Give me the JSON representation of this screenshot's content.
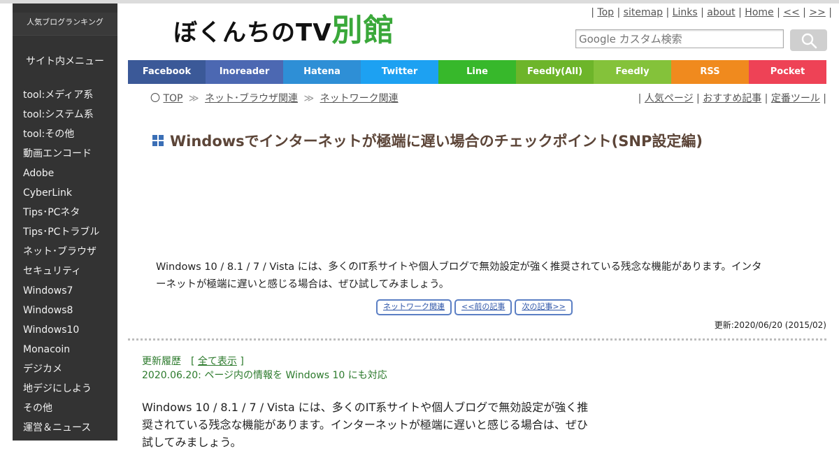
{
  "sidebar": {
    "ranking_label": "人気ブログランキング",
    "menu_title": "サイト内メニュー",
    "items": [
      "tool:メディア系",
      "tool:システム系",
      "tool:その他",
      "動画エンコード",
      "Adobe",
      "CyberLink",
      "Tips･PCネタ",
      "Tips･PCトラブル",
      "ネット･ブラウザ",
      "セキュリティ",
      "Windows7",
      "Windows8",
      "Windows10",
      "Monacoin",
      "デジカメ",
      "地デジにしよう",
      "その他",
      "運営＆ニュース"
    ]
  },
  "header": {
    "logo_main": "ぼくんちのTV",
    "logo_accent": "別館",
    "links": [
      "Top",
      "sitemap",
      "Links",
      "about",
      "Home",
      "<<",
      ">>"
    ],
    "search_placeholder": "Google カスタム検索"
  },
  "social": [
    {
      "label": "Facebook",
      "color": "#3b5998"
    },
    {
      "label": "Inoreader",
      "color": "#4c68b2"
    },
    {
      "label": "Hatena",
      "color": "#2e8fd6"
    },
    {
      "label": "Twitter",
      "color": "#1da1f2"
    },
    {
      "label": "Line",
      "color": "#37b82b"
    },
    {
      "label": "Feedly(All)",
      "color": "#6db52a"
    },
    {
      "label": "Feedly",
      "color": "#84c23a"
    },
    {
      "label": "RSS",
      "color": "#f08a1e"
    },
    {
      "label": "Pocket",
      "color": "#ee4256"
    }
  ],
  "breadcrumb": {
    "marker": "〇",
    "items": [
      "TOP",
      "ネット･ブラウザ関連",
      "ネットワーク関連"
    ],
    "sep": "≫"
  },
  "subnav": [
    "人気ページ",
    "おすすめ記事",
    "定番ツール"
  ],
  "article": {
    "title": "Windowsでインターネットが極端に遅い場合のチェックポイント(SNP設定編)",
    "intro": "Windows 10 / 8.1 / 7 / Vista には、多くのIT系サイトや個人ブログで無効設定が強く推奨されている残念な機能があります。インターネットが極端に遅いと感じる場合は、ぜひ試してみましょう。",
    "pills": [
      "ネットワーク関連",
      "<<前の記事",
      "次の記事>>"
    ],
    "updated": "更新:2020/06/20 (2015/02)",
    "history_label": "更新履歴　[",
    "history_link": "全て表示",
    "history_close": "]",
    "history_entry": "2020.06.20: ページ内の情報を Windows 10 にも対応",
    "body": "Windows 10 / 8.1 / 7 / Vista には、多くのIT系サイトや個人ブログで無効設定が強く推奨されている残念な機能があります。インターネットが極端に遅いと感じる場合は、ぜひ試してみましょう。"
  }
}
